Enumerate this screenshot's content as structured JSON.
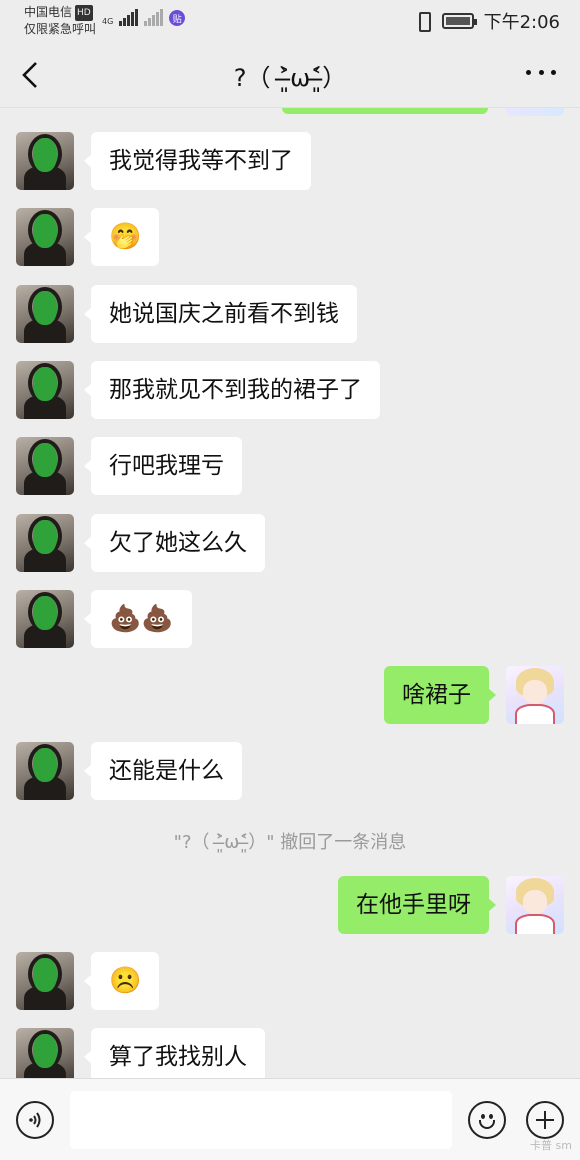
{
  "status_bar": {
    "carrier": "中国电信",
    "hd_badge": "HD",
    "emergency": "仅限紧急呼叫",
    "network": "4G",
    "app_badge": "贴",
    "time": "下午2:06"
  },
  "header": {
    "title": "?（ ˃̶͈̀ω˂̶͈́）"
  },
  "messages": [
    {
      "side": "left",
      "text": "我觉得我等不到了"
    },
    {
      "side": "left",
      "text": "🤭"
    },
    {
      "side": "left",
      "text": "她说国庆之前看不到钱"
    },
    {
      "side": "left",
      "text": "那我就见不到我的裙子了"
    },
    {
      "side": "left",
      "text": "行吧我理亏"
    },
    {
      "side": "left",
      "text": "欠了她这么久"
    },
    {
      "side": "left",
      "text": "💩💩"
    },
    {
      "side": "right",
      "text": "啥裙子"
    },
    {
      "side": "left",
      "text": "还能是什么"
    },
    {
      "side": "system",
      "text": "\"?（ ˃̶͈̀ω˂̶͈́）\" 撤回了一条消息"
    },
    {
      "side": "right",
      "text": "在他手里呀"
    },
    {
      "side": "left",
      "text": "☹️"
    },
    {
      "side": "left",
      "text": "算了我找别人"
    }
  ],
  "input_bar": {
    "voice_icon": "voice-icon",
    "emoji_icon": "emoji-icon",
    "plus_icon": "plus-icon",
    "watermark": "卡普 sm"
  },
  "colors": {
    "background": "#ededed",
    "sent_bubble": "#95ec69",
    "received_bubble": "#ffffff",
    "system_text": "#9a9a9a"
  }
}
